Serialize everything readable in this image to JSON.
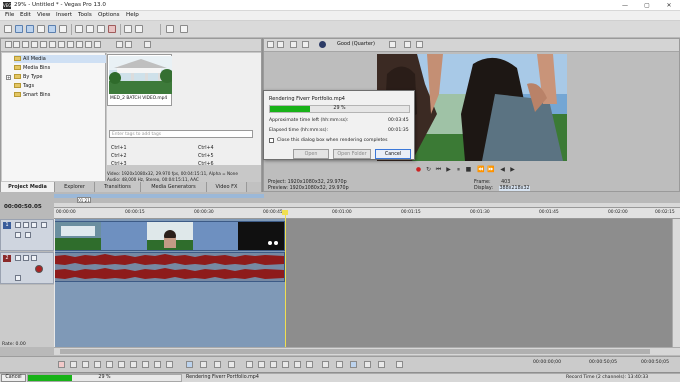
{
  "window": {
    "title": "29% - Untitled * - Vegas Pro 13.0",
    "app_icon": "VEG",
    "min": "—",
    "max": "▢",
    "close": "✕"
  },
  "menu": [
    "File",
    "Edit",
    "View",
    "Insert",
    "Tools",
    "Options",
    "Help"
  ],
  "explorer": {
    "tree": [
      "All Media",
      "Media Bins",
      "By Type",
      "Tags",
      "Smart Bins"
    ],
    "thumb_label": "MED_2 BATCH VIDEO.mp4",
    "search_placeholder": "Enter tags to add tags",
    "shortcuts_left": [
      "Ctrl+1",
      "Ctrl+2",
      "Ctrl+3"
    ],
    "shortcuts_right": [
      "Ctrl+4",
      "Ctrl+5",
      "Ctrl+6"
    ],
    "info_line1": "Video: 1920x1080x32, 29.970 fps, 00:04:15:11, Alpha = None",
    "info_line2": "Audio: 48,000 Hz, Stereo, 00:04:15:11, AAC",
    "tabs": [
      "Project Media",
      "Explorer",
      "Transitions",
      "Media Generators",
      "Video FX"
    ]
  },
  "preview": {
    "quality": "Good (Quarter)",
    "project_label": "Project:",
    "project_value": "1920x1080x32, 29.970p",
    "preview_label": "Preview:",
    "preview_value": "1920x1080x32, 29.970p",
    "frame_label": "Frame:",
    "frame_value": "403",
    "display_label": "Display:",
    "display_value": "388x218x32"
  },
  "dialog": {
    "title": "Rendering Fiverr Portfolio.mp4",
    "progress_text": "29 %",
    "progress": 0.29,
    "time_left_label": "Approximate time left (hh:mm:ss):",
    "time_left_value": "00:03:45",
    "elapsed_label": "Elapsed time (hh:mm:ss):",
    "elapsed_value": "00:01:35",
    "checkbox_label": "Close this dialog box when rendering completes",
    "open_label": "Open",
    "open_folder_label": "Open Folder",
    "cancel_label": "Cancel"
  },
  "timeline": {
    "timecode": "00:00:50.05",
    "loop_badge": "01:21",
    "ruler": [
      "00:00:00",
      "00:00:15",
      "00:00:30",
      "00:00:45",
      "00:01:00",
      "00:01:15",
      "00:01:30",
      "00:01:45",
      "00:02:00",
      "00:02:15"
    ],
    "track1_num": "1",
    "track2_num": "2",
    "rate": "Rate: 0.00"
  },
  "transport": {
    "time1": "00:00:00;00",
    "time2": "00:00:50;05",
    "time3": "00:00:50;05"
  },
  "status": {
    "cancel_label": "Cancel",
    "progress_text": "29 %",
    "progress": 0.29,
    "render_text": "Rendering Fiverr Portfolio.mp4",
    "record_time": "Record Time (2 channels): 13:40:33"
  },
  "colors": {
    "accent": "#3c78d8",
    "progress_green": "#18b218",
    "timeline_bg": "#7f99b7",
    "audio_wave": "#8e1b1b",
    "video_track": "#6e90c0"
  }
}
